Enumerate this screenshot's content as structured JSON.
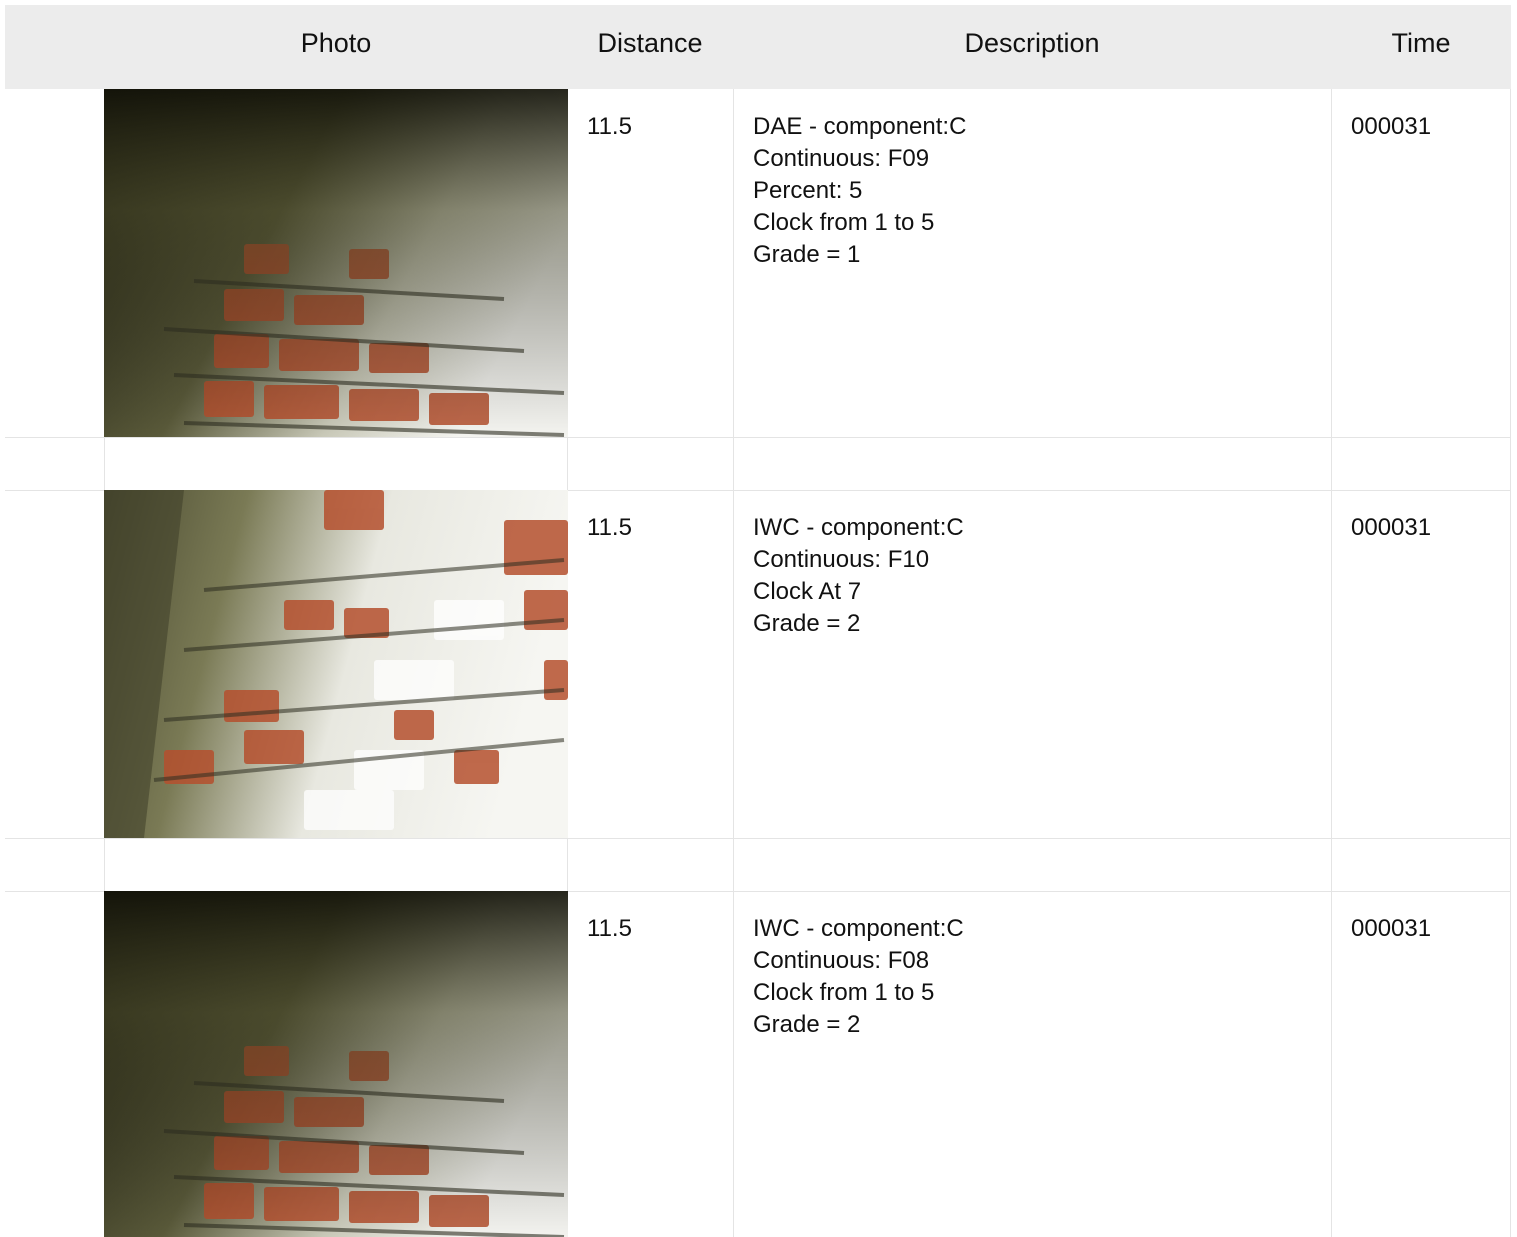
{
  "table": {
    "headers": {
      "photo": "Photo",
      "distance": "Distance",
      "description": "Description",
      "time": "Time"
    },
    "rows": [
      {
        "photo_icon": "brick-pipe-photo",
        "distance": "11.5",
        "description": [
          "DAE - component:C",
          "Continuous: F09",
          "Percent: 5",
          "Clock from 1 to 5",
          "Grade = 1"
        ],
        "time": "000031"
      },
      {
        "photo_icon": "brick-pipe-photo",
        "distance": "11.5",
        "description": [
          "IWC - component:C",
          "Continuous: F10",
          "Clock At 7",
          "Grade = 2"
        ],
        "time": "000031"
      },
      {
        "photo_icon": "brick-pipe-photo",
        "distance": "11.5",
        "description": [
          "IWC - component:C",
          "Continuous: F08",
          "Clock from 1 to 5",
          "Grade = 2"
        ],
        "time": "000031"
      }
    ]
  },
  "colors": {
    "header_bg": "#ececec",
    "grid_line": "#e4e4e4",
    "brick": "#b5502e",
    "mortar": "#3a3a2a"
  }
}
